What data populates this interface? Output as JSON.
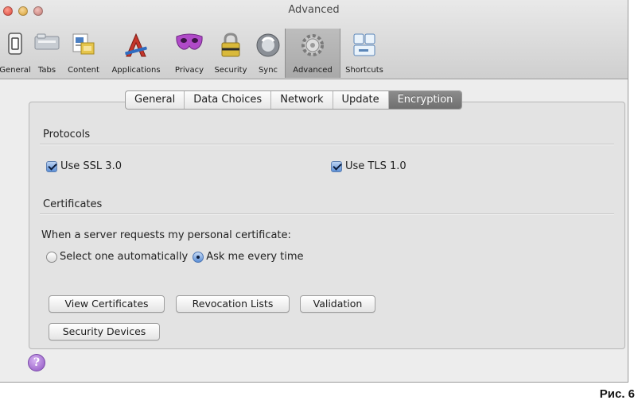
{
  "window": {
    "title": "Advanced"
  },
  "toolbar": {
    "items": [
      {
        "label": "General",
        "icon": "switch-icon"
      },
      {
        "label": "Tabs",
        "icon": "tabs-icon"
      },
      {
        "label": "Content",
        "icon": "content-icon"
      },
      {
        "label": "Applications",
        "icon": "applications-icon"
      },
      {
        "label": "Privacy",
        "icon": "privacy-mask-icon"
      },
      {
        "label": "Security",
        "icon": "padlock-icon"
      },
      {
        "label": "Sync",
        "icon": "sync-icon"
      },
      {
        "label": "Advanced",
        "icon": "gear-icon",
        "selected": true
      },
      {
        "label": "Shortcuts",
        "icon": "keyboard-icon"
      }
    ]
  },
  "tabs": [
    {
      "label": "General"
    },
    {
      "label": "Data Choices"
    },
    {
      "label": "Network"
    },
    {
      "label": "Update"
    },
    {
      "label": "Encryption",
      "active": true
    }
  ],
  "protocols": {
    "heading": "Protocols",
    "ssl_label": "Use SSL 3.0",
    "ssl_checked": true,
    "tls_label": "Use TLS 1.0",
    "tls_checked": true
  },
  "certificates": {
    "heading": "Certificates",
    "prompt": "When a server requests my personal certificate:",
    "option_auto": "Select one automatically",
    "option_ask": "Ask me every time",
    "selected": "Ask me every time"
  },
  "buttons": {
    "view_certificates": "View Certificates",
    "revocation_lists": "Revocation Lists",
    "validation": "Validation",
    "security_devices": "Security Devices"
  },
  "help": {
    "glyph": "?"
  },
  "caption": "Рис. 6",
  "colors": {
    "accent": "#5c8fd6",
    "active_tab": "#7a7a7a",
    "help": "#8d52c1"
  }
}
